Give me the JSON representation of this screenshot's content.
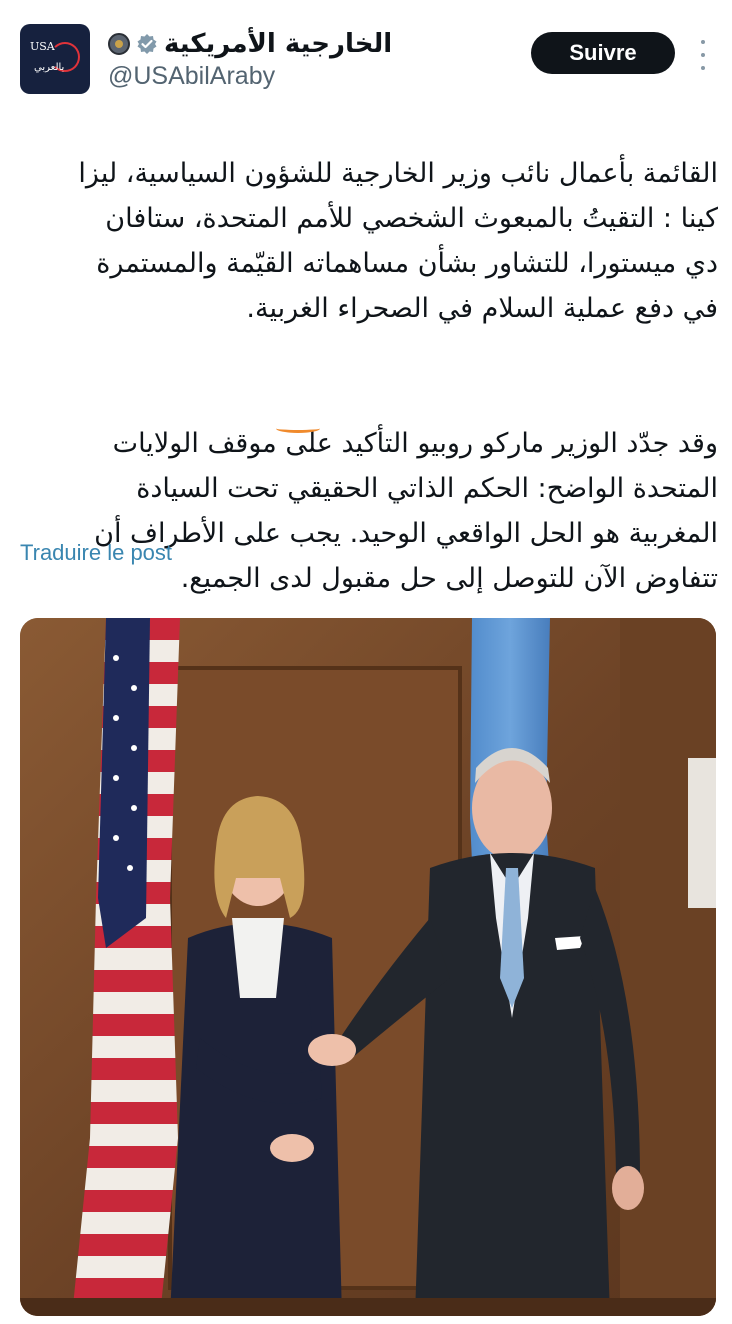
{
  "account": {
    "display_name": "الخارجية الأمريكية",
    "handle": "@USAbilAraby",
    "avatar_text_top": "USA",
    "avatar_text_bottom": "بالعربي"
  },
  "follow_button": {
    "label": "Suivre"
  },
  "tweet": {
    "paragraph1": "القائمة بأعمال نائب وزير الخارجية للشؤون السياسية، ليزا\nكينا : التقيتُ بالمبعوث الشخصي للأمم المتحدة، ستافان\nدي ميستورا، للتشاور بشأن مساهماته القيّمة والمستمرة\nفي دفع عملية السلام في الصحراء الغربية.",
    "paragraph2": "وقد جدّد الوزير ماركو روبيو التأكيد على موقف الولايات\nالمتحدة الواضح: الحكم الذاتي الحقيقي تحت السيادة\nالمغربية هو الحل الواقعي الوحيد. يجب على الأطراف أن\nتتفاوض الآن للتوصل إلى حل مقبول لدى الجميع."
  },
  "translate_link": "Traduire le post",
  "icons": {
    "seal": "state-department-seal-icon",
    "verified": "verified-badge-icon",
    "more": "more-vertical-icon"
  },
  "colors": {
    "follow_bg": "#0f1419",
    "link": "#3a86b0",
    "verified": "#829aab",
    "highlight_underline": "#f08a2c"
  }
}
